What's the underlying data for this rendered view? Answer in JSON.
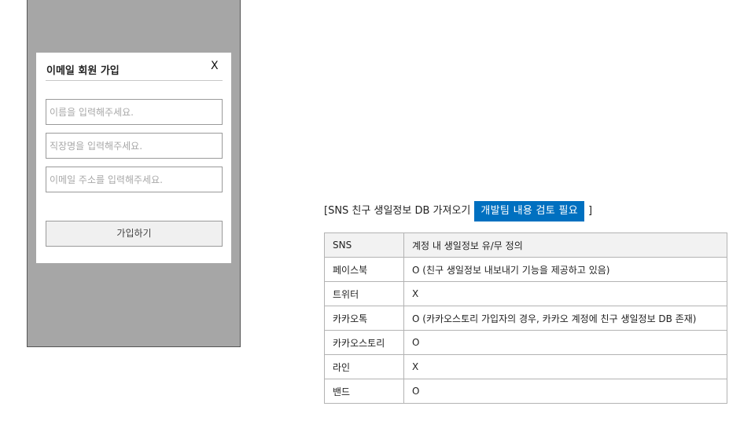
{
  "signup_modal": {
    "title": "이메일 회원 가입",
    "close_label": "X",
    "name_placeholder": "이름을 입력해주세요.",
    "company_placeholder": "직장명을 입력해주세요.",
    "email_placeholder": "이메일 주소를 입력해주세요.",
    "submit_label": "가입하기"
  },
  "spec": {
    "heading_prefix": "[SNS 친구 생일정보 DB 가져오기",
    "badge_text": "개발팀 내용 검토 필요",
    "badge_color": "#0070c0",
    "heading_suffix": "]",
    "table": {
      "headers": [
        "SNS",
        "계정 내 생일정보 유/무 정의"
      ],
      "rows": [
        [
          "페이스북",
          "O (친구 생일정보 내보내기 기능을 제공하고 있음)"
        ],
        [
          "트위터",
          "X"
        ],
        [
          "카카오톡",
          "O (카카오스토리 가입자의 경우, 카카오 계정에 친구 생일정보 DB 존재)"
        ],
        [
          "카카오스토리",
          "O"
        ],
        [
          "라인",
          "X"
        ],
        [
          "밴드",
          "O"
        ]
      ]
    }
  }
}
